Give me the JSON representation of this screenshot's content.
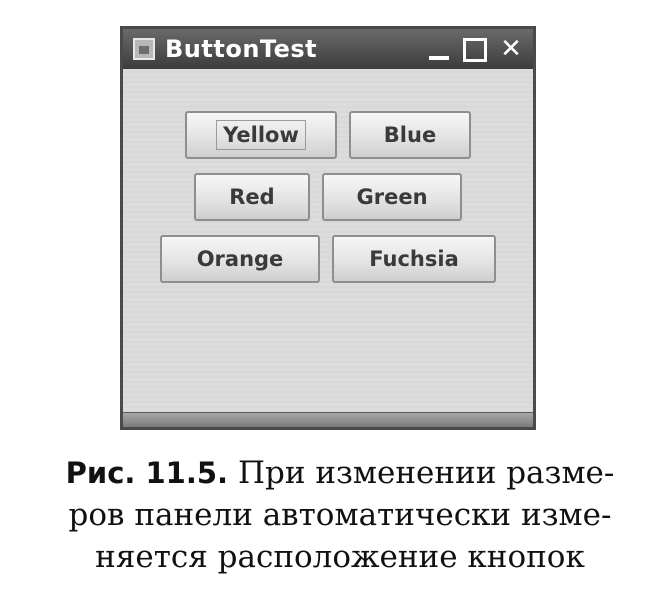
{
  "window": {
    "title": "ButtonTest",
    "controls": {
      "minimize_icon": "minimize-icon",
      "maximize_icon": "maximize-icon",
      "close_glyph": "✕"
    }
  },
  "buttons": {
    "yellow": "Yellow",
    "blue": "Blue",
    "red": "Red",
    "green": "Green",
    "orange": "Orange",
    "fuchsia": "Fuchsia"
  },
  "caption": {
    "label": "Рис. 11.5.",
    "line1": "При изменении разме-",
    "line2": "ров панели автоматически изме-",
    "line3": "няется расположение кнопок"
  }
}
